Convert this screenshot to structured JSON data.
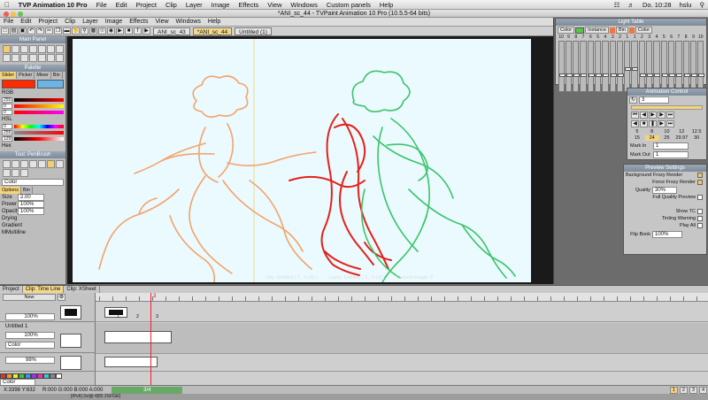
{
  "mac_menu": {
    "app_name": "TVP Animation 10 Pro",
    "items": [
      "File",
      "Edit",
      "Project",
      "Clip",
      "Layer",
      "Image",
      "Effects",
      "View",
      "Windows",
      "Custom panels",
      "Help"
    ],
    "clock": "Do. 10:28",
    "user": "hslu"
  },
  "window_title": "*ANI_sc_44 - TVPaint Animation 10 Pro (10.5.5-64 bits)",
  "app_menu": [
    "File",
    "Edit",
    "Project",
    "Clip",
    "Layer",
    "Image",
    "Effects",
    "View",
    "Windows",
    "Help"
  ],
  "doc_tabs": [
    "ANI_sc_43",
    "*ANI_sc_44",
    "Untitled (1)"
  ],
  "panels": {
    "main": {
      "title": "Main Panel"
    },
    "palette": {
      "title": "Palette",
      "tabs": [
        "Slider",
        "Picker",
        "Mixer",
        "Bin"
      ],
      "rgb_label": "RGB",
      "rgb_values": [
        "255",
        "0",
        "0"
      ],
      "hsl_label": "HSL",
      "hsl_values": [
        "0",
        "255",
        "129"
      ],
      "hex_label": "Hex"
    },
    "tool": {
      "title": "Tool: PenBrush",
      "mode": "Color",
      "tabs": [
        "Options",
        "Bin"
      ],
      "size_label": "Size",
      "size_value": "2.00",
      "power_label": "Power",
      "power_value": "100%",
      "opacity_label": "Opacity",
      "opacity_value": "100%",
      "drying_label": "Drying",
      "gradient_label": "Gradient",
      "multiline_label": "MMultiline"
    }
  },
  "light_table": {
    "title": "Light Table",
    "mode": "Color",
    "instance_label": "Instance",
    "bin_label": "Bin",
    "color_label": "Color",
    "fader_numbers": [
      "10",
      "9",
      "8",
      "7",
      "6",
      "5",
      "4",
      "3",
      "2",
      "1",
      "1",
      "2",
      "3",
      "4",
      "5",
      "6",
      "7",
      "8",
      "9",
      "10"
    ],
    "fader_levels": [
      0.3,
      0.3,
      0.3,
      0.3,
      0.3,
      0.3,
      0.3,
      0.3,
      0.3,
      0.45,
      0.45,
      0.3,
      0.3,
      0.3,
      0.3,
      0.3,
      0.3,
      0.3,
      0.3,
      0.3
    ]
  },
  "animation_control": {
    "title": "Animation Control",
    "frame_value": "3",
    "fps_top": [
      "5",
      "8",
      "10",
      "12",
      "12.5"
    ],
    "fps_bottom": [
      "15",
      "24",
      "25",
      "29.97",
      "30"
    ],
    "fps_selected": "24",
    "mark_in_label": "Mark In",
    "mark_in_value": "1",
    "mark_out_label": "Mark Out",
    "mark_out_value": "1"
  },
  "preview_settings": {
    "title": "Preview Settings",
    "background_label": "Background Frozy Render",
    "render_label": "Force Frozy Render",
    "quality_label": "Quality",
    "quality_value": "30%",
    "full_quality_label": "Full Quality Preview",
    "show_tc_label": "Show TC",
    "tinting_label": "Tinting Warning",
    "play_all_label": "Play All",
    "flip_book_label": "Flip Book",
    "flip_book_value": "100%"
  },
  "canvas_status": {
    "clip": "Clip: Untitled ( 1 , 0 (4) )",
    "layer": "Layer: Untitled ( 1 , 0 (4) )",
    "image": "Current image: 3"
  },
  "timeline": {
    "tabs": [
      "Project",
      "Clip: Time Line",
      "Clip: XSheet"
    ],
    "new_label": "New",
    "layers": [
      {
        "name": "",
        "opacity": "100%",
        "mode": "Color"
      },
      {
        "name": "Untitled 1",
        "opacity": "100%",
        "mode": "Color"
      },
      {
        "name": "",
        "opacity": "98%",
        "mode": "Color"
      }
    ],
    "frame_marks": [
      "1",
      "2",
      "3"
    ],
    "current_frame": "3",
    "footer_mode": "Color"
  },
  "statusbar": {
    "coords": "X:3398  Y:632",
    "rgb": "R:000 G:000 B:000 A:000",
    "frame_counter": "3/4",
    "page_buttons": [
      "1",
      "2",
      "3",
      "4"
    ]
  },
  "footer_text": "[IPv6] 2sl@ 4[fl2 2SFGkl]"
}
